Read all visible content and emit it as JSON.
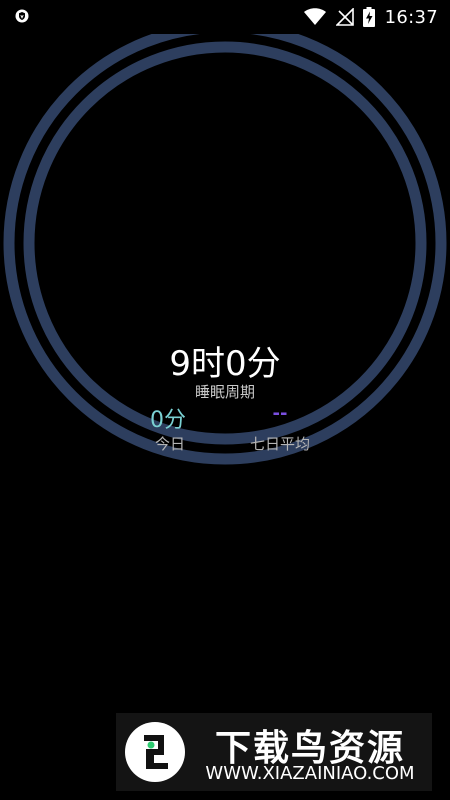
{
  "status_bar": {
    "time": "16:37",
    "icons": [
      "shield-icon",
      "wifi-icon",
      "no-signal-icon",
      "battery-charging-icon"
    ]
  },
  "sleep": {
    "total_duration": "9时0分",
    "cycle_label": "睡眠周期",
    "today_value": "0分",
    "today_label": "今日",
    "avg_value": "--",
    "avg_label": "七日平均"
  },
  "watermark": {
    "title": "下载鸟资源",
    "url": "WWW.XIAZAINIAO.COM"
  },
  "colors": {
    "background": "#000000",
    "ring": "#2d3e5e",
    "today_accent": "#7ad1d3",
    "avg_accent": "#7a4fe0",
    "logo_green": "#2ecc71"
  }
}
